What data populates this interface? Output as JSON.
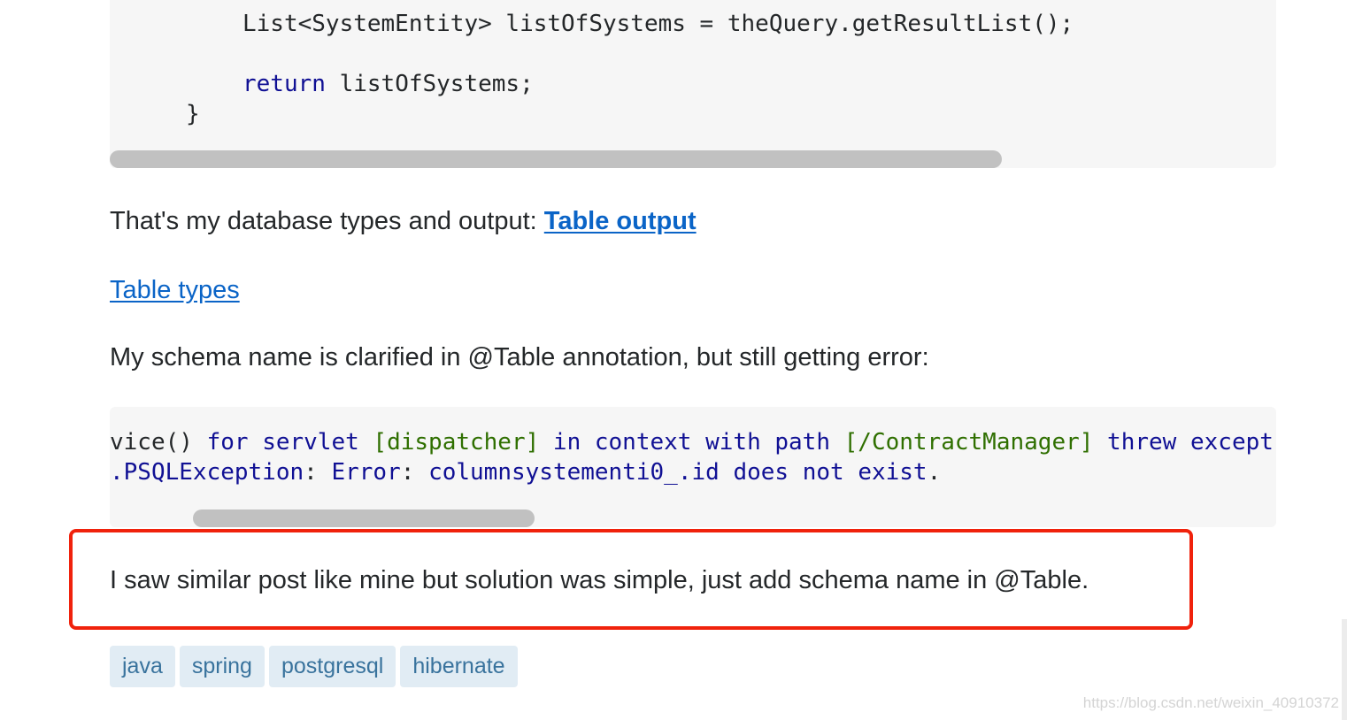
{
  "code_block_1": {
    "line_1": "List<SystemEntity> listOfSystems = theQuery.getResultList();",
    "line_2_keyword": "return",
    "line_2_rest": " listOfSystems;",
    "line_3": "}"
  },
  "paragraph_1": {
    "text": "That's my database types and output: ",
    "link": "Table output"
  },
  "paragraph_2": {
    "link": "Table types"
  },
  "paragraph_3": {
    "text": "My schema name is clarified in @Table annotation, but still getting error:"
  },
  "code_block_2": {
    "line_1_a": "vice()",
    "line_1_b": " for servlet ",
    "line_1_c": "[dispatcher]",
    "line_1_d": " in context with path ",
    "line_1_e": "[/ContractManager]",
    "line_1_f": " threw except",
    "line_2_a": ".PSQLException",
    "line_2_b": ": ",
    "line_2_c": "Error",
    "line_2_d": ": ",
    "line_2_e": "columnsystementi0_",
    "line_2_f": ".id does not exist",
    "line_2_g": "."
  },
  "paragraph_4": {
    "text": "I saw similar post like mine but solution was simple, just add schema name in @Table."
  },
  "tags": [
    "java",
    "spring",
    "postgresql",
    "hibernate"
  ],
  "watermark": "https://blog.csdn.net/weixin_40910372",
  "colors": {
    "link": "#0a64c7",
    "highlight_border": "#f0220c",
    "tag_bg": "#e1ecf4",
    "tag_text": "#39739d",
    "code_bg": "#f6f6f6"
  }
}
